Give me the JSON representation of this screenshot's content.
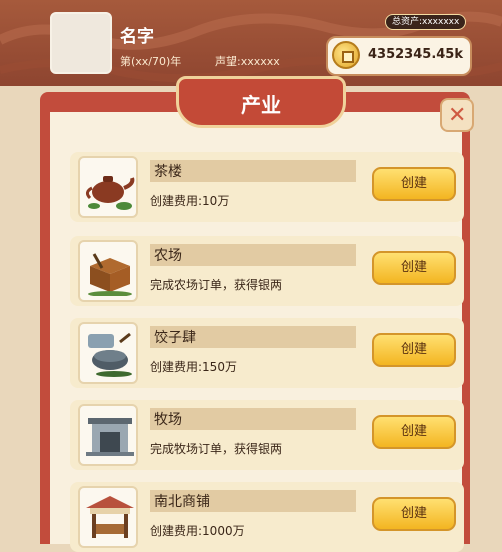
{
  "player": {
    "name": "名字",
    "year_text": "第(xx/70)年",
    "fame_label": "声望:",
    "fame_value": "xxxxxx"
  },
  "assets": {
    "label": "总资产:xxxxxxx"
  },
  "money": {
    "value": "4352345.45k",
    "icon": "coin-icon"
  },
  "panel": {
    "title": "产业",
    "close_icon": "close-icon"
  },
  "industries": [
    {
      "name": "茶楼",
      "desc": "创建费用:10万",
      "button": "创建",
      "icon": "teapot-icon"
    },
    {
      "name": "农场",
      "desc": "完成农场订单，获得银两",
      "button": "创建",
      "icon": "crate-icon"
    },
    {
      "name": "饺子肆",
      "desc": "创建费用:150万",
      "button": "创建",
      "icon": "dumpling-icon"
    },
    {
      "name": "牧场",
      "desc": "完成牧场订单，获得银两",
      "button": "创建",
      "icon": "gate-icon"
    },
    {
      "name": "南北商铺",
      "desc": "创建费用:1000万",
      "button": "创建",
      "icon": "stall-icon"
    }
  ],
  "colors": {
    "header": "#8e4530",
    "panel_border": "#c24c3c",
    "card_bg": "#f7ebcd",
    "button": "#f3b521"
  }
}
